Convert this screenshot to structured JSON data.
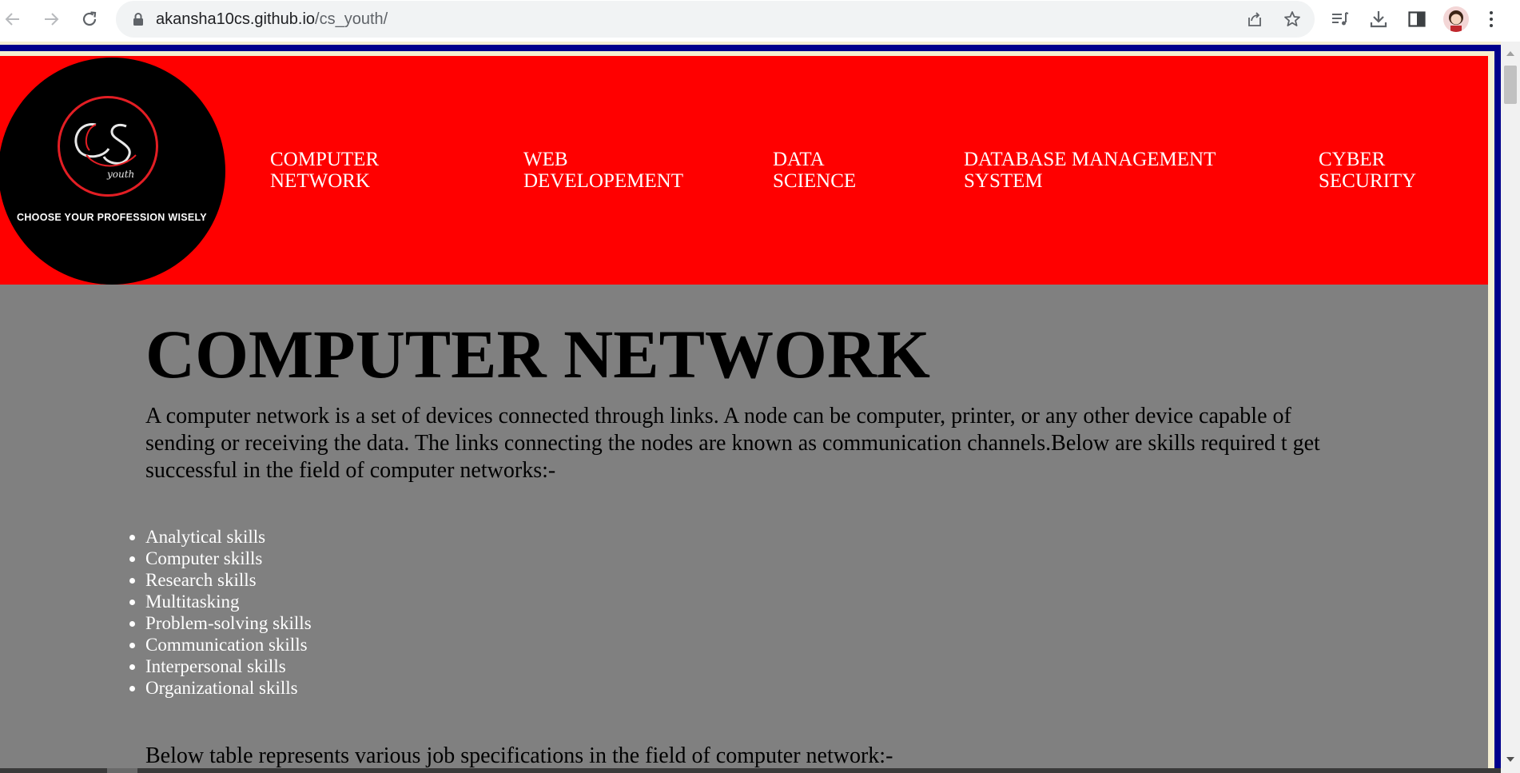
{
  "browser": {
    "back_label": "←",
    "forward_label": "→",
    "reload_label": "⟳",
    "url_host": "akansha10cs.github.io",
    "url_path": "/cs_youth/",
    "icons": [
      "lock-icon",
      "share-icon",
      "star-icon",
      "reading-list-icon",
      "download-icon",
      "side-panel-icon",
      "profile-avatar",
      "menu-icon"
    ]
  },
  "site": {
    "logo_tagline": "CHOOSE YOUR PROFESSION WISELY",
    "logo_text": "CS",
    "logo_script": "youth",
    "nav": [
      {
        "label": "COMPUTER\nNETWORK"
      },
      {
        "label": "WEB\nDEVELOPEMENT"
      },
      {
        "label": "DATA\nSCIENCE"
      },
      {
        "label": "DATABASE MANAGEMENT\nSYSTEM"
      },
      {
        "label": "CYBER\nSECURITY"
      }
    ],
    "colors": {
      "header": "#ff0000",
      "content_bg": "#808080",
      "frame": "#00008b"
    }
  },
  "main": {
    "heading": "COMPUTER NETWORK",
    "intro": "A computer network is a set of devices connected through links. A node can be computer, printer, or any other device capable of sending or receiving the data. The links connecting the nodes are known as communication channels.Below are skills required t get successful in the field of computer networks:-",
    "skills": [
      "Analytical skills",
      "Computer skills",
      "Research skills",
      "Multitasking",
      "Problem-solving skills",
      "Communication skills",
      "Interpersonal skills",
      "Organizational skills"
    ],
    "table_intro": "Below table represents various job specifications in the field of computer network:-"
  }
}
